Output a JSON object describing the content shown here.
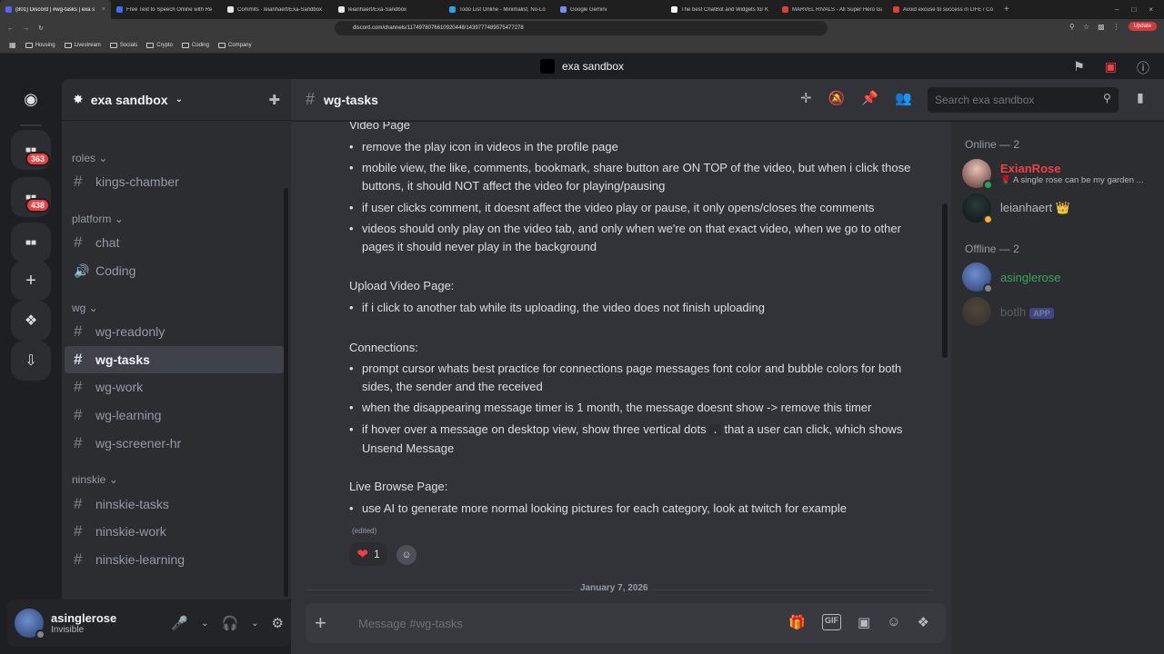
{
  "browser": {
    "tabs": [
      {
        "label": "(801) Discord | #wg-tasks | exa s",
        "fav": "#5865f2",
        "active": true
      },
      {
        "label": "Free Text to Speech Online with Re",
        "fav": "#3b6ef0",
        "active": false
      },
      {
        "label": "Commits · leianhaert/Exa-Sandbox",
        "fav": "#e6e6e6",
        "active": false
      },
      {
        "label": "leianhaert/Exa-Sandbox",
        "fav": "#e6e6e6",
        "active": false
      },
      {
        "label": "Todo List Online - Minimalist, No-Lo",
        "fav": "#2ea2e2",
        "active": false
      },
      {
        "label": "Google Gemini",
        "fav": "#7b8cf0",
        "active": false
      },
      {
        "label": "The best ChatBot and Widgets for K",
        "fav": "#ffffff",
        "active": false
      },
      {
        "label": "MARVEL RIVALS - All Super Hero Ga",
        "fav": "#e23b3b",
        "active": false
      },
      {
        "label": "Avoid excuse to success in LIFE / Co",
        "fav": "#e23b3b",
        "active": false
      }
    ],
    "new_tab": "+",
    "url": "discord.com/channels/1174978076610920448/1439777489575477278",
    "update_label": "Update",
    "bookmarks": [
      "Housing",
      "Livestream",
      "Socials",
      "Crypto",
      "Coding",
      "Company"
    ]
  },
  "app": {
    "window_title": "exa sandbox"
  },
  "rail": {
    "badges": [
      "363",
      "438"
    ]
  },
  "sidebar": {
    "server_name": "exa sandbox",
    "categories": {
      "roles": "roles",
      "platform": "platform",
      "wg": "wg",
      "ninskie": "ninskie"
    },
    "channels": {
      "kings_chamber": "kings-chamber",
      "chat": "chat",
      "coding": "Coding",
      "wg_readonly": "wg-readonly",
      "wg_tasks": "wg-tasks",
      "wg_work": "wg-work",
      "wg_learning": "wg-learning",
      "wg_screener_hr": "wg-screener-hr",
      "ninskie_tasks": "ninskie-tasks",
      "ninskie_work": "ninskie-work",
      "ninskie_learning": "ninskie-learning"
    }
  },
  "user": {
    "name": "asinglerose",
    "status": "Invisible"
  },
  "chat_header": {
    "channel": "wg-tasks",
    "search_placeholder": "Search exa sandbox"
  },
  "messages": {
    "video_title": "Video Page",
    "video_items": [
      "remove the play icon in videos in the profile page",
      "mobile view, the like, comments, bookmark, share button are ON TOP of the video, but when i click those buttons, it should NOT affect the video for playing/pausing",
      "if user clicks comment, it doesnt affect the video play or pause, it only opens/closes the comments",
      "videos should only play on the video tab, and only when we're on that exact video, when we go to other pages it should never play in the background"
    ],
    "upload_title": "Upload Video Page:",
    "upload_items": [
      "if i click to another tab while its uploading, the video does not finish uploading"
    ],
    "connections_title": "Connections:",
    "connections_items": [
      "prompt cursor whats best practice for connections page messages font color and bubble  colors for both sides, the sender and the received",
      "when the disappearing message timer is 1 month, the message doesnt show -> remove this timer"
    ],
    "hover_pre": "if hover over a message on desktop view, show three vertical dots",
    "hover_code": ".",
    "hover_post": "that a user can click, which shows Unsend Message",
    "live_title": "Live Browse Page:",
    "live_items": [
      "use AI to generate more normal looking pictures for each category, look at twitch for example"
    ],
    "edited": "(edited)",
    "reaction_count": "1",
    "date_divider": "January 7, 2026"
  },
  "composer": {
    "placeholder": "Message #wg-tasks"
  },
  "members": {
    "online_header": "Online — 2",
    "offline_header": "Offline — 2",
    "list": [
      {
        "name": "ExianRose",
        "status": "🌹 A single rose can be my garden ...",
        "color": "#f23f43"
      },
      {
        "name": "leianhaert",
        "crown": "👑",
        "color": "#b5bac1"
      },
      {
        "name": "asinglerose",
        "color": "#3ba55c"
      },
      {
        "name": "botlh",
        "tag": "APP",
        "color": "#4e5058"
      }
    ]
  }
}
